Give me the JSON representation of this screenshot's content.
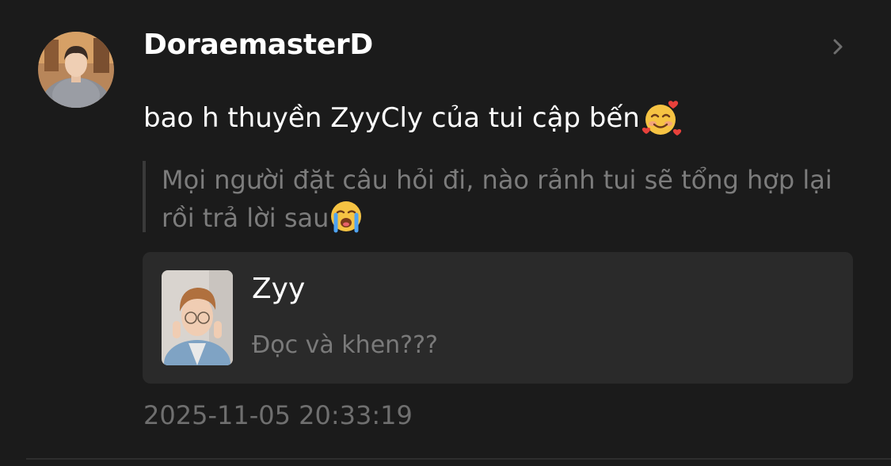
{
  "comment": {
    "username": "DoraemasterD",
    "text": "bao h thuyền ZyyCly của tui cập bến",
    "text_emoji": "smiling-face-with-hearts",
    "quote_text": "Mọi người đặt câu hỏi đi, nào rảnh tui sẽ tổng hợp lại rồi trả lời sau",
    "quote_emoji": "loudly-crying-face",
    "timestamp": "2025-11-05 20:33:19"
  },
  "linked_card": {
    "title": "Zyy",
    "subtitle": "Đọc và khen???"
  },
  "colors": {
    "background": "#1b1b1b",
    "card_background": "#2a2a2a",
    "muted_text": "#7c7c7c"
  }
}
